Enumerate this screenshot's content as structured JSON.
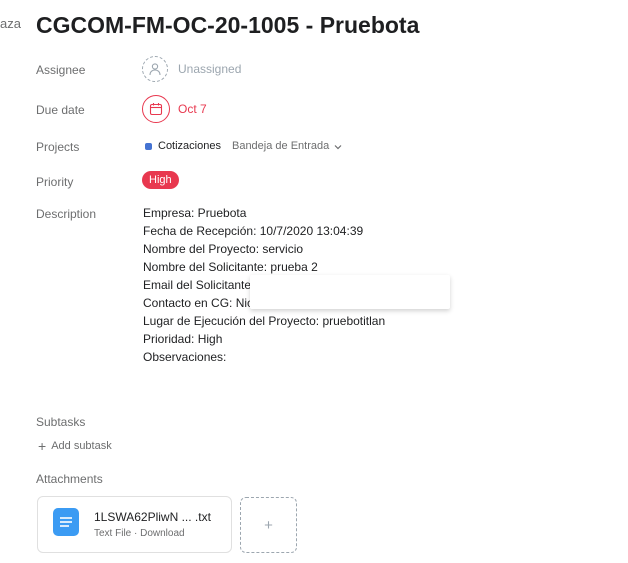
{
  "edge_tab": "aza",
  "task": {
    "title": "CGCOM-FM-OC-20-1005 - Pruebota"
  },
  "fields": {
    "assignee": {
      "label": "Assignee",
      "value": "Unassigned",
      "icon": "user-icon"
    },
    "due_date": {
      "label": "Due date",
      "value": "Oct 7",
      "icon": "calendar-icon"
    },
    "projects": {
      "label": "Projects",
      "project": "Cotizaciones",
      "section": "Bandeja de Entrada",
      "project_color": "#4573d2"
    },
    "priority": {
      "label": "Priority",
      "value": "High",
      "color": "#e8384f"
    },
    "description": {
      "label": "Description",
      "lines": [
        "Empresa: Pruebota",
        "Fecha de Recepción: 10/7/2020 13:04:39",
        "Nombre del Proyecto: servicio",
        "Nombre del Solicitante: prueba 2",
        "Email del Solicitante:",
        "Contacto en CG: Nico",
        "Lugar de Ejecución del Proyecto: pruebotitlan",
        "Prioridad: High",
        "Observaciones:"
      ]
    }
  },
  "subtasks": {
    "label": "Subtasks",
    "add_label": "Add subtask"
  },
  "attachments": {
    "label": "Attachments",
    "items": [
      {
        "name": "1LSWA62PliwN ... .txt",
        "meta": "Text File · Download",
        "icon": "text-file-icon"
      }
    ],
    "add_label": "+"
  },
  "colors": {
    "accent_red": "#e8384f",
    "text_secondary": "#6d6e6f",
    "file_blue": "#3b9bf3"
  }
}
